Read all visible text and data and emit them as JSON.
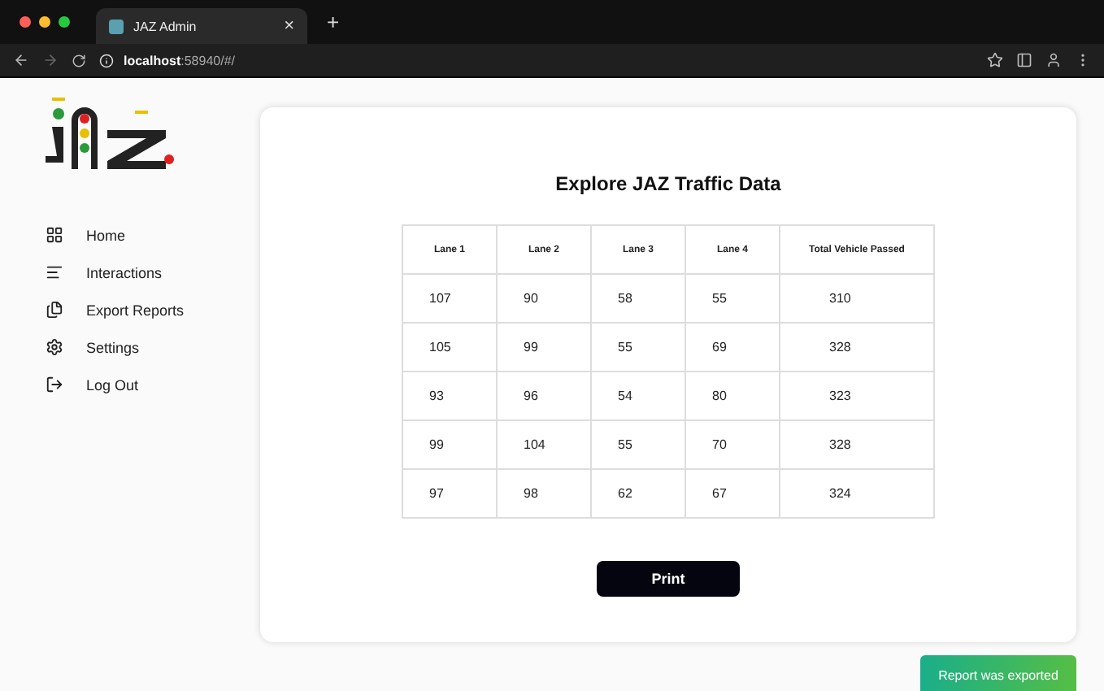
{
  "browser": {
    "tab_title": "JAZ Admin",
    "tab_close": "×",
    "new_tab": "+",
    "url_host": "localhost",
    "url_rest": ":58940/#/"
  },
  "sidebar": {
    "items": [
      {
        "label": "Home"
      },
      {
        "label": "Interactions"
      },
      {
        "label": "Export Reports"
      },
      {
        "label": "Settings"
      },
      {
        "label": "Log Out"
      }
    ]
  },
  "main": {
    "title": "Explore JAZ Traffic Data",
    "table": {
      "columns": [
        "Lane 1",
        "Lane 2",
        "Lane 3",
        "Lane 4",
        "Total Vehicle Passed"
      ],
      "rows": [
        [
          "107",
          "90",
          "58",
          "55",
          "310"
        ],
        [
          "105",
          "99",
          "55",
          "69",
          "328"
        ],
        [
          "93",
          "96",
          "54",
          "80",
          "323"
        ],
        [
          "99",
          "104",
          "55",
          "70",
          "328"
        ],
        [
          "97",
          "98",
          "62",
          "67",
          "324"
        ]
      ]
    },
    "print_button": "Print"
  },
  "toast": "Report was exported"
}
